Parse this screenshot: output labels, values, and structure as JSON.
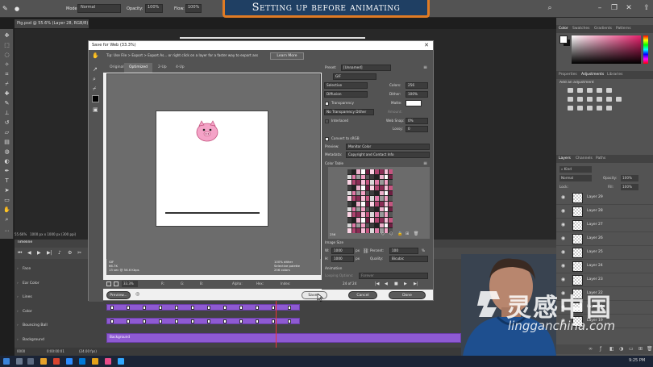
{
  "banner": {
    "title": "Setting up before animating"
  },
  "options_bar": {
    "mode_label": "Mode:",
    "mode_value": "Normal",
    "opacity_label": "Opacity:",
    "opacity_value": "100%",
    "flow_label": "Flow:",
    "flow_value": "100%"
  },
  "document": {
    "tab_title": "Pig.psd @ 55.6% (Layer 28, RGB/8) *",
    "zoom": "55.66%",
    "size": "1000 px x 1000 px (300 ppi)"
  },
  "dialog": {
    "title": "Save for Web (33.3%)",
    "tip": "Tip: Use File > Export > Export As... or right click on a layer for a faster way to export ass",
    "learn_more": "Learn More",
    "tabs": [
      "Original",
      "Optimized",
      "2-Up",
      "4-Up"
    ],
    "active_tab": "Optimized",
    "preview_info_left": [
      "GIF",
      "66.7K",
      "13 sec @ 56.6 Kbps"
    ],
    "preview_info_right": [
      "100% dither",
      "Selective palette",
      "256 colors"
    ],
    "zoom_value": "33.3%",
    "bottom": {
      "r": "R:",
      "g": "G:",
      "b": "B:",
      "alpha": "Alpha:",
      "hex": "Hex:",
      "index": "Index:"
    },
    "buttons": {
      "preview": "Preview...",
      "save": "Save...",
      "cancel": "Cancel",
      "done": "Done"
    },
    "settings": {
      "preset_label": "Preset:",
      "preset_value": "[Unnamed]",
      "format": "GIF",
      "reduction": "Selective",
      "colors_label": "Colors:",
      "colors_value": "256",
      "dither_algo": "Diffusion",
      "dither_label": "Dither:",
      "dither_value": "100%",
      "transparency_label": "Transparency",
      "matte_label": "Matte:",
      "transparency_dither": "No Transparency Dither",
      "amount_label": "Amount:",
      "interlaced_label": "Interlaced",
      "websnap_label": "Web Snap:",
      "websnap_value": "0%",
      "lossy_label": "Lossy:",
      "lossy_value": "0",
      "convert_srgb": "Convert to sRGB",
      "preview_label": "Preview:",
      "preview_value": "Monitor Color",
      "metadata_label": "Metadata:",
      "metadata_value": "Copyright and Contact Info",
      "color_table_label": "Color Table",
      "color_table_count": "256",
      "image_size_label": "Image Size",
      "w_label": "W:",
      "w_value": "1000",
      "h_label": "H:",
      "h_value": "1000",
      "px": "px",
      "percent_label": "Percent:",
      "percent_value": "100",
      "percent_unit": "%",
      "quality_label": "Quality:",
      "quality_value": "Bicubic",
      "animation_label": "Animation",
      "looping_label": "Looping Options:",
      "looping_value": "Forever",
      "frame_counter": "24 of 24"
    }
  },
  "right_panel": {
    "color_tabs": [
      "Color",
      "Swatches",
      "Gradients",
      "Patterns"
    ],
    "adj_tabs": [
      "Properties",
      "Adjustments",
      "Libraries"
    ],
    "adj_hint": "Add an adjustment",
    "layer_tabs": [
      "Layers",
      "Channels",
      "Paths"
    ],
    "kind_label": "Kind",
    "blend_mode": "Normal",
    "opacity_label": "Opacity:",
    "opacity_value": "100%",
    "lock_label": "Lock:",
    "fill_label": "Fill:",
    "fill_value": "100%",
    "layers": [
      "Layer 29",
      "Layer 28",
      "Layer 27",
      "Layer 26",
      "Layer 25",
      "Layer 24",
      "Layer 23",
      "Layer 22",
      "Layer 21",
      "Layer 19"
    ]
  },
  "timeline": {
    "title": "Timeline",
    "rows": [
      "Face",
      "Ear Color",
      "Lines",
      "Color",
      "Bouncing Ball",
      "Background"
    ],
    "background_clip": "Background",
    "timecode": "0:00:00:01",
    "fps": "(24.00 fps)",
    "frame_count": "0000"
  },
  "taskbar": {
    "time": "9:25 PM"
  },
  "watermark": {
    "cn": "灵感中国",
    "en": "lingganchina.com"
  }
}
